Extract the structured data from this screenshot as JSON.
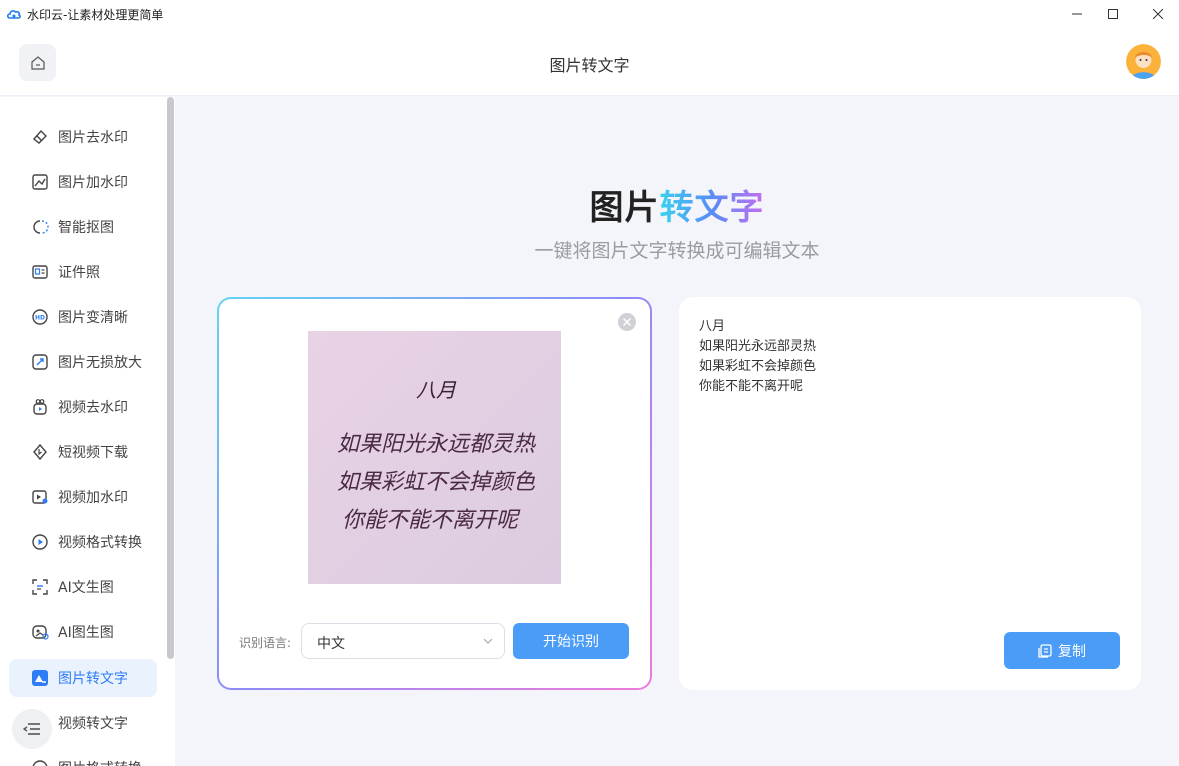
{
  "window": {
    "title": "水印云-让素材处理更简单",
    "minimize_icon": "minimize-icon",
    "maximize_icon": "maximize-icon",
    "close_icon": "close-icon"
  },
  "header": {
    "title": "图片转文字",
    "home_icon": "home-icon",
    "avatar": "user-avatar"
  },
  "sidebar": {
    "items": [
      {
        "label": "图片去水印",
        "icon": "eraser-icon"
      },
      {
        "label": "图片加水印",
        "icon": "image-edit-icon"
      },
      {
        "label": "智能抠图",
        "icon": "cutout-icon"
      },
      {
        "label": "证件照",
        "icon": "id-card-icon"
      },
      {
        "label": "图片变清晰",
        "icon": "hd-icon"
      },
      {
        "label": "图片无损放大",
        "icon": "enlarge-icon"
      },
      {
        "label": "视频去水印",
        "icon": "video-clean-icon"
      },
      {
        "label": "短视频下载",
        "icon": "download-icon"
      },
      {
        "label": "视频加水印",
        "icon": "video-watermark-icon"
      },
      {
        "label": "视频格式转换",
        "icon": "video-convert-icon"
      },
      {
        "label": "AI文生图",
        "icon": "ai-text-image-icon"
      },
      {
        "label": "AI图生图",
        "icon": "ai-image-image-icon"
      },
      {
        "label": "图片转文字",
        "icon": "image-text-icon",
        "active": true
      },
      {
        "label": "视频转文字",
        "icon": "video-text-icon"
      },
      {
        "label": "图片格式转换",
        "icon": "image-convert-icon"
      }
    ],
    "collapse_icon": "menu-collapse-icon"
  },
  "main": {
    "hero_title_plain": "图片",
    "hero_title_accent": "转文字",
    "hero_subtitle": "一键将图片文字转换成可编辑文本",
    "upload": {
      "close_icon": "remove-image-icon",
      "lang_label": "识别语言:",
      "lang_value": "中文",
      "start_label": "开始识别"
    },
    "result": {
      "lines": [
        "八月",
        "如果阳光永远部灵热",
        "如果彩虹不会掉颜色",
        "你能不能不离开呢"
      ],
      "copy_label": "复制"
    },
    "image_text": {
      "title": "八月",
      "lines": [
        "如果阳光永远都灵热",
        "如果彩虹不会掉颜色",
        "你能不能不离开呢"
      ]
    }
  },
  "colors": {
    "accent": "#4a9cf7",
    "active_bg": "#eaf2fe",
    "page_bg": "#f3f5fa"
  }
}
